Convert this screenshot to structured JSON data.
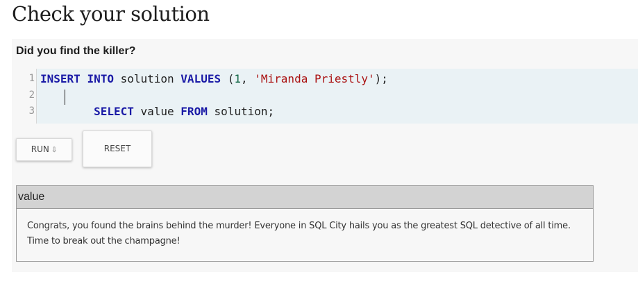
{
  "page": {
    "title": "Check your solution"
  },
  "panel": {
    "heading": "Did you find the killer?"
  },
  "editor": {
    "line_numbers": [
      "1",
      "2",
      "3"
    ],
    "lines": [
      {
        "tokens": [
          {
            "t": "INSERT",
            "c": "kw"
          },
          {
            "t": " ",
            "c": ""
          },
          {
            "t": "INTO",
            "c": "kw"
          },
          {
            "t": " solution ",
            "c": ""
          },
          {
            "t": "VALUES",
            "c": "kw"
          },
          {
            "t": " (",
            "c": ""
          },
          {
            "t": "1",
            "c": "num"
          },
          {
            "t": ", ",
            "c": ""
          },
          {
            "t": "'Miranda Priestly'",
            "c": "str"
          },
          {
            "t": ");",
            "c": ""
          }
        ]
      },
      {
        "tokens": []
      },
      {
        "tokens": [
          {
            "t": "        ",
            "c": ""
          },
          {
            "t": "SELECT",
            "c": "kw"
          },
          {
            "t": " value ",
            "c": ""
          },
          {
            "t": "FROM",
            "c": "kw"
          },
          {
            "t": " solution;",
            "c": ""
          }
        ]
      }
    ]
  },
  "buttons": {
    "run_label": "RUN",
    "run_icon": "⇩",
    "reset_label": "RESET"
  },
  "result": {
    "column_header": "value",
    "cell": "Congrats, you found the brains behind the murder! Everyone in SQL City hails you as the greatest SQL detective of all time. Time to break out the champagne!"
  },
  "colors": {
    "keyword": "#1a1aa6",
    "string": "#aa1111",
    "number": "#116644",
    "editor_bg": "#eaf2f5",
    "panel_bg": "#f7f7f7",
    "table_header_bg": "#d3d3d3"
  }
}
